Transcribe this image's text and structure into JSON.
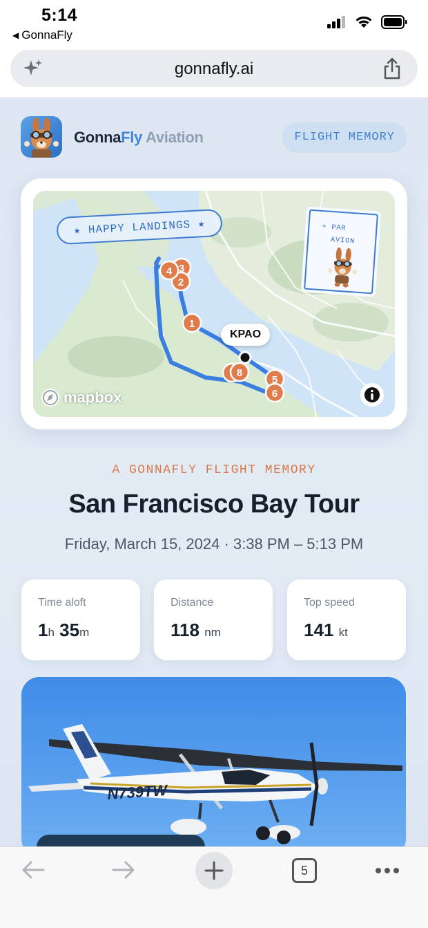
{
  "status_bar": {
    "time": "5:14",
    "back_app": "GonnaFly"
  },
  "browser": {
    "url": "gonnafly.ai",
    "tab_count": "5"
  },
  "brand": {
    "name_part1": "Gonna",
    "name_part2": "Fly",
    "name_part3": " Aviation",
    "badge": "FLIGHT MEMORY"
  },
  "map": {
    "label": "★ HAPPY LANDINGS ★",
    "stamp_line1": "PAR",
    "stamp_line2": "AVION",
    "airport": "KPAO",
    "attribution": "mapbox",
    "waypoints": [
      "1",
      "2",
      "3",
      "4",
      "5",
      "6",
      "7",
      "8"
    ]
  },
  "flight": {
    "eyebrow": "A GONNAFLY FLIGHT MEMORY",
    "title": "San Francisco Bay Tour",
    "date": "Friday, March 15, 2024 · 3:38 PM – 5:13 PM"
  },
  "stats": [
    {
      "label": "Time aloft",
      "value_a": "1",
      "unit_a": "h",
      "value_b": "35",
      "unit_b": "m"
    },
    {
      "label": "Distance",
      "value": "118",
      "unit": "nm"
    },
    {
      "label": "Top speed",
      "value": "141",
      "unit": "kt"
    }
  ],
  "photo": {
    "tail_number": "N739TW"
  },
  "colors": {
    "accent_blue": "#3d86d8",
    "accent_orange": "#d97a4a",
    "route_blue": "#3a7fe0",
    "waypoint_orange": "#e07b4c"
  }
}
